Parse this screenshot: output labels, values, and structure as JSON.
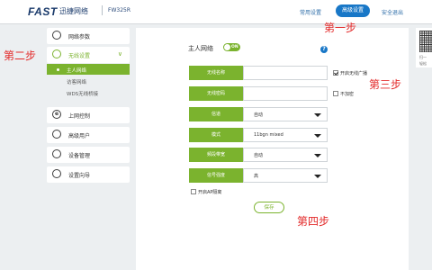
{
  "header": {
    "logo": "FAST",
    "brand": "迅捷网络",
    "model": "FW325R",
    "nav": [
      "常用设置",
      "高级设置",
      "安全退出"
    ],
    "active_nav_index": 1
  },
  "sidebar": {
    "items": [
      {
        "label": "网络参数",
        "icon": "globe-icon",
        "glyph": "○"
      },
      {
        "label": "无线设置",
        "icon": "wifi-icon",
        "glyph": "◎",
        "open": true,
        "children": [
          "主人网络",
          "访客网络",
          "WDS无线桥接"
        ],
        "active_child": 0
      },
      {
        "label": "上网控制",
        "icon": "ie-icon",
        "glyph": "e"
      },
      {
        "label": "高级用户",
        "icon": "user-icon",
        "glyph": "♙"
      },
      {
        "label": "设备管理",
        "icon": "gear-icon",
        "glyph": "⚙"
      },
      {
        "label": "设置向导",
        "icon": "wizard-icon",
        "glyph": "◉"
      }
    ]
  },
  "main": {
    "section_title": "主人网络",
    "toggle_label": "ON",
    "help": "?",
    "fields": [
      {
        "label": "无线名称",
        "value": "",
        "dropdown": false
      },
      {
        "label": "无线密码",
        "value": "",
        "dropdown": false
      },
      {
        "label": "信道",
        "value": "自动",
        "dropdown": true
      },
      {
        "label": "模式",
        "value": "11bgn mixed",
        "dropdown": true
      },
      {
        "label": "频段带宽",
        "value": "自动",
        "dropdown": true
      },
      {
        "label": "信号强度",
        "value": "高",
        "dropdown": true
      }
    ],
    "broadcast_label": "开启无线广播",
    "broadcast_checked": true,
    "no_encrypt_label": "不加密",
    "no_encrypt_checked": false,
    "ap_isolation_label": "开启AP隔离",
    "ap_isolation_checked": false,
    "save_label": "保存"
  },
  "qr": {
    "line1": "扫一",
    "line2": "轻松"
  },
  "annotations": {
    "step1": "第一步",
    "step2": "第二步",
    "step3": "第三步",
    "step4": "第四步"
  },
  "colors": {
    "accent_green": "#7bb32e",
    "brand_blue": "#1877c7",
    "annotation_red": "#e32b2b"
  }
}
